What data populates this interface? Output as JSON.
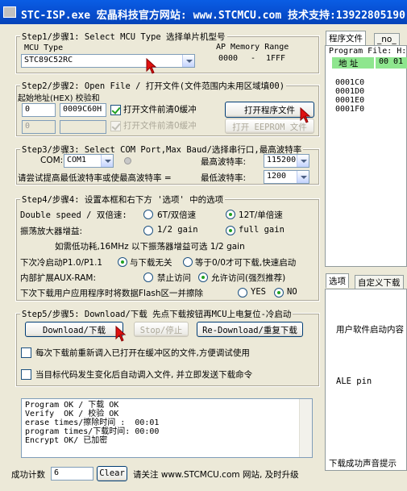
{
  "window": {
    "title": "STC-ISP.exe  宏晶科技官方网站: www.STCMCU.com  技术支持:13922805190"
  },
  "step1": {
    "label": "Step1/步骤1: Select MCU Type  选择单片机型号",
    "mcu_type_label": "MCU Type",
    "mcu_value": "STC89C52RC",
    "ap_label": "AP Memory Range",
    "ap_start": "0000",
    "ap_sep": "-",
    "ap_end": "1FFF"
  },
  "step2": {
    "label": "Step2/步骤2: Open File / 打开文件(文件范围内未用区域填00)",
    "start_addr_label": "起始地址(HEX) 校验和",
    "addr1": "0",
    "checksum1": "0009C60H",
    "clear_buffer_label": "打开文件前清0缓冲",
    "clear_buffer_checked": true,
    "open_file_button": "打开程序文件",
    "addr2": "0",
    "clear_buffer2_label": "打开文件前清0缓冲",
    "open_eeprom_button": "打开 EEPROM 文件"
  },
  "step3": {
    "label": "Step3/步骤3: Select COM Port,Max Baud/选择串行口,最高波特率",
    "com_label": "COM:",
    "com_value": "COM1",
    "max_baud_label": "最高波特率:",
    "max_baud_value": "115200",
    "hint_label": "请尝试提高最低波特率或使最高波特率 =",
    "min_baud_label": "最低波特率:",
    "min_baud_value": "1200"
  },
  "step4": {
    "label": "Step4/步骤4: 设置本框和右下方 '选项' 中的选项",
    "speed_label": "Double speed / 双倍速:",
    "speed_opt1": "6T/双倍速",
    "speed_opt2": "12T/单倍速",
    "osc_label": "振荡放大器增益:",
    "osc_opt1": "1/2 gain",
    "osc_opt2": "full gain",
    "osc_note": "如需低功耗,16MHz 以下振荡器增益可选 1/2 gain",
    "p10_label": "下次冷启动P1.0/P1.1",
    "p10_opt1": "与下载无关",
    "p10_opt2": "等于0/0才可下载,快速启动",
    "auxram_label": "内部扩展AUX-RAM:",
    "auxram_opt1": "禁止访问",
    "auxram_opt2": "允许访问(强烈推荐)",
    "erase_label": "下次下载用户应用程序时将数据Flash区一并擦除",
    "erase_yes": "YES",
    "erase_no": "NO"
  },
  "step5": {
    "label": "Step5/步骤5: Download/下载  先点下载按钮再MCU上电复位-冷启动",
    "download_button": "Download/下载",
    "stop_button": "Stop/停止",
    "redownload_button": "Re-Download/重复下载",
    "reload_label": "每次下载前重新调入已打开在缓冲区的文件,方便调试使用",
    "auto_label": "当目标代码发生变化后自动调入文件, 并立即发送下载命令"
  },
  "log": {
    "lines": [
      "Program OK / 下载 OK",
      "Verify  OK / 校验 OK",
      "erase times/擦除时间 :  00:01",
      "program times/下载时间: 00:00",
      "Encrypt OK/ 已加密"
    ]
  },
  "status": {
    "success_label": "成功计数",
    "success_count": "6",
    "clear_button": "Clear",
    "visit_text": "请关注 www.STCMCU.com 网站, 及时升级"
  },
  "right": {
    "tab_program_file": "程序文件",
    "tab_no": "_no_",
    "program_file_label": "Program File: H:",
    "addr_header": "地 址",
    "val_header": "00 01",
    "rows": [
      "0001C0",
      "0001D0",
      "0001E0",
      "0001F0"
    ],
    "tab_options": "选项",
    "tab_custom": "自定义下载",
    "user_soft_label": "用户软件启动内容",
    "ale_label": "ALE pin",
    "download_sound_label": "下载成功声音提示"
  }
}
